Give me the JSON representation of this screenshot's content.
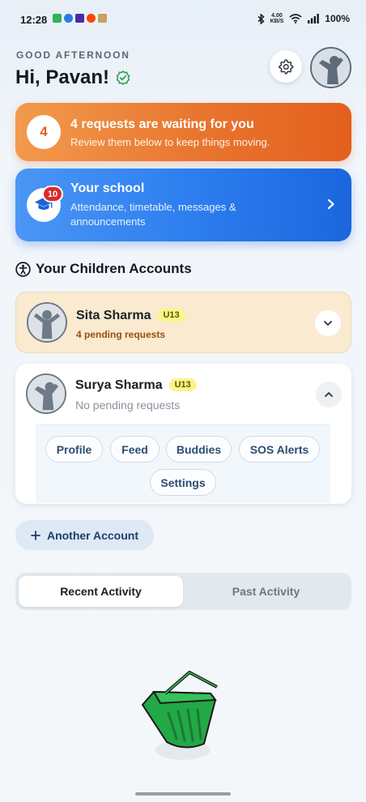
{
  "status_bar": {
    "time": "12:28",
    "net_speed_top": "4.00",
    "net_speed_bottom": "KB/S",
    "battery": "100%",
    "notification_icons": [
      "messages-icon",
      "chat-icon",
      "app-icon",
      "reddit-icon",
      "bag-icon"
    ],
    "system_icons": [
      "bluetooth-icon",
      "wifi-icon",
      "signal-icon"
    ]
  },
  "header": {
    "greeting_small": "GOOD AFTERNOON",
    "greeting_big": "Hi, Pavan!",
    "verified_icon": "verified-check-icon",
    "settings_icon": "gear-icon"
  },
  "requests_card": {
    "count": "4",
    "title": "4 requests are waiting for you",
    "subtitle": "Review them below to keep things moving."
  },
  "school_card": {
    "badge": "10",
    "title": "Your school",
    "subtitle": "Attendance, timetable, messages & announcements",
    "icon": "graduation-cap-icon"
  },
  "children_section": {
    "title": "Your Children Accounts",
    "icon": "accessibility-person-icon"
  },
  "children": [
    {
      "name": "Sita Sharma",
      "age_group": "U13",
      "status": "4 pending requests",
      "expanded": false
    },
    {
      "name": "Surya Sharma",
      "age_group": "U13",
      "status": "No pending requests",
      "expanded": true,
      "menu": [
        "Profile",
        "Feed",
        "Buddies",
        "SOS Alerts",
        "Settings"
      ]
    }
  ],
  "add_account": {
    "label": "Another Account"
  },
  "activity_tabs": {
    "tabs": [
      "Recent Activity",
      "Past Activity"
    ],
    "selected": "Recent Activity"
  },
  "colors": {
    "requests_orange": "#e8752f",
    "school_blue": "#2e7ff0",
    "badge_red": "#d82b2b",
    "age_badge_yellow": "#fbf58a",
    "pending_card": "#f9ead0",
    "basket_green": "#22a847"
  }
}
